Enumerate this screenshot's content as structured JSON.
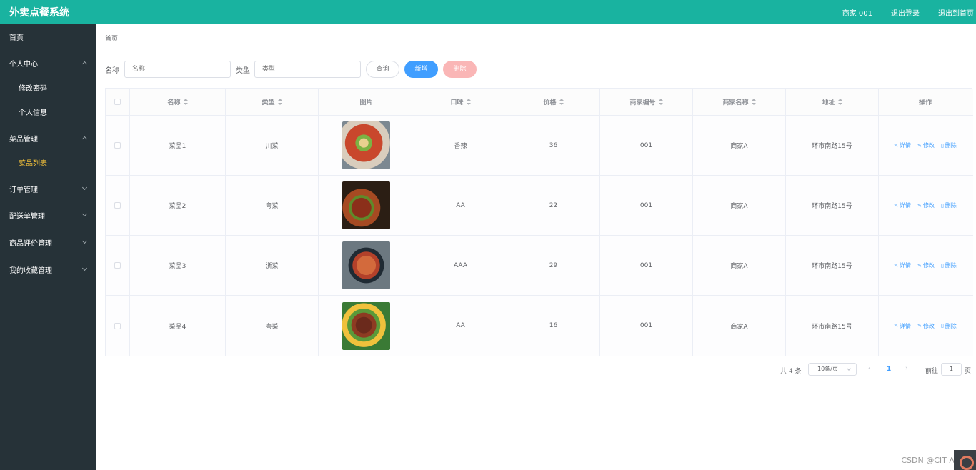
{
  "header": {
    "brand": "外卖点餐系统",
    "merchant": "商家 001",
    "logout": "退出登录",
    "exit_home": "退出到首页"
  },
  "sidebar": {
    "items": [
      {
        "label": "首页"
      },
      {
        "label": "个人中心"
      },
      {
        "label": "修改密码"
      },
      {
        "label": "个人信息"
      },
      {
        "label": "菜品管理"
      },
      {
        "label": "菜品列表"
      },
      {
        "label": "订单管理"
      },
      {
        "label": "配送单管理"
      },
      {
        "label": "商品评价管理"
      },
      {
        "label": "我的收藏管理"
      }
    ]
  },
  "breadcrumb": "首页",
  "search": {
    "name_label": "名称",
    "name_placeholder": "名称",
    "type_label": "类型",
    "type_placeholder": "类型",
    "query_label": "查询",
    "add_label": "新增",
    "delete_label": "删除"
  },
  "table": {
    "headers": [
      "名称",
      "类型",
      "图片",
      "口味",
      "价格",
      "商家编号",
      "商家名称",
      "地址",
      "操作"
    ],
    "rows": [
      {
        "name": "菜品1",
        "type": "川菜",
        "taste": "香辣",
        "price": "36",
        "merchant_no": "001",
        "merchant_name": "商家A",
        "address": "环市南路15号"
      },
      {
        "name": "菜品2",
        "type": "粤菜",
        "taste": "AA",
        "price": "22",
        "merchant_no": "001",
        "merchant_name": "商家A",
        "address": "环市南路15号"
      },
      {
        "name": "菜品3",
        "type": "浙菜",
        "taste": "AAA",
        "price": "29",
        "merchant_no": "001",
        "merchant_name": "商家A",
        "address": "环市南路15号"
      },
      {
        "name": "菜品4",
        "type": "粤菜",
        "taste": "AA",
        "price": "16",
        "merchant_no": "001",
        "merchant_name": "商家A",
        "address": "环市南路15号"
      }
    ],
    "ops": {
      "detail": "详情",
      "edit": "修改",
      "delete": "删除"
    }
  },
  "pagination": {
    "total": "共 4 条",
    "page_size": "10条/页",
    "current_page": "1",
    "goto_label": "前往",
    "goto_value": "1",
    "page_unit": "页"
  },
  "watermark": "CSDN @CIT ARD",
  "colors": {
    "topbar": "#19b3a0",
    "sidebar": "#263238",
    "active": "#f6c33a",
    "primary": "#409eff",
    "danger_disabled": "#fab6b6"
  }
}
